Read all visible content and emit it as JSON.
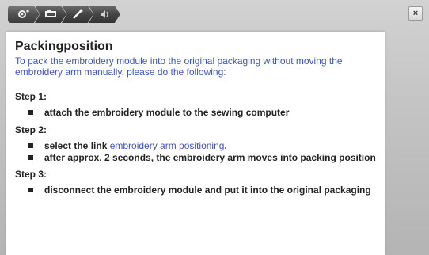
{
  "tabs": [
    {
      "icon": "settings-icon"
    },
    {
      "icon": "embroidery-module-icon"
    },
    {
      "icon": "tool-icon"
    },
    {
      "icon": "sound-icon"
    }
  ],
  "close_label": "×",
  "content": {
    "title": "Packingposition",
    "intro": "To pack the embroidery module into the original packaging without moving the embroidery arm manually, please do the following:",
    "steps": [
      {
        "heading": "Step 1:",
        "items": [
          {
            "text": "attach the embroidery module to the sewing computer"
          }
        ]
      },
      {
        "heading": "Step 2:",
        "items": [
          {
            "prefix": "select the link ",
            "link": "embroidery arm positioning",
            "suffix": "."
          },
          {
            "text": "after approx. 2 seconds, the embroidery arm moves into packing position"
          }
        ]
      },
      {
        "heading": "Step 3:",
        "items": [
          {
            "text": "disconnect the embroidery module and put it into the original packaging"
          }
        ]
      }
    ]
  },
  "colors": {
    "link_blue": "#3d55c8",
    "text_dark": "#222222",
    "tab_dark": "#454545"
  }
}
